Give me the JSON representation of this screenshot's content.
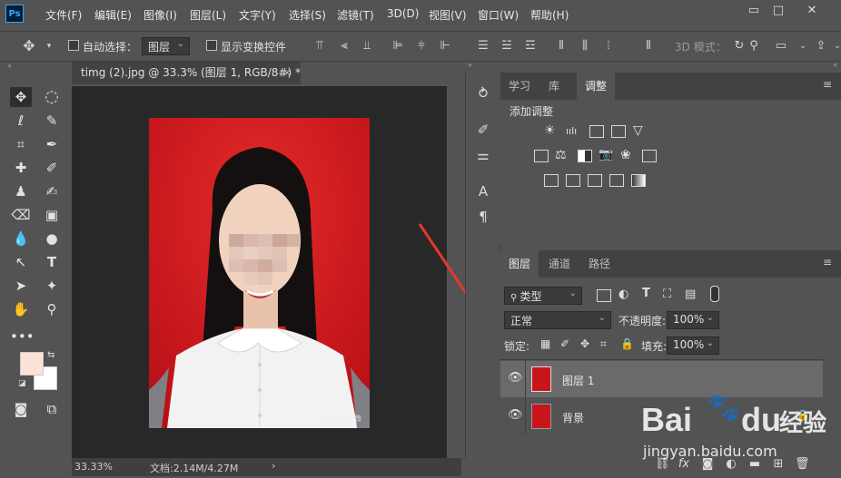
{
  "app": {
    "logo_text": "Ps"
  },
  "menu": [
    "文件(F)",
    "编辑(E)",
    "图像(I)",
    "图层(L)",
    "文字(Y)",
    "选择(S)",
    "滤镜(T)",
    "3D(D)",
    "视图(V)",
    "窗口(W)",
    "帮助(H)"
  ],
  "window_controls": {
    "minimize": "▭",
    "restore": "□",
    "close": "✕"
  },
  "options_bar": {
    "auto_select_label": "自动选择：",
    "layer_dropdown": "图层",
    "show_transform_label": "显示变换控件",
    "mode_3d_label": "3D 模式："
  },
  "document": {
    "tab_title": "timg (2).jpg @ 33.3% (图层 1, RGB/8#) *",
    "close_glyph": "×",
    "zoom": "33.33%",
    "doc_size": "文档:2.14M/4.27M",
    "watermark": "头条@小微"
  },
  "colors": {
    "foreground": "#fde3d7",
    "background": "#ffffff",
    "accent_arrow": "#e23a2e"
  },
  "adjust_panel": {
    "tabs": [
      "学习",
      "库",
      "调整"
    ],
    "active_tab": "调整",
    "title": "添加调整"
  },
  "layers_panel": {
    "tabs": [
      "图层",
      "通道",
      "路径"
    ],
    "active_tab": "图层",
    "filter_label": "类型",
    "blend_mode": "正常",
    "opacity_label": "不透明度:",
    "opacity_value": "100%",
    "lock_label": "锁定:",
    "fill_label": "填充:",
    "fill_value": "100%",
    "layers": [
      {
        "name": "图层 1",
        "visible": true,
        "selected": true
      },
      {
        "name": "背景",
        "visible": true,
        "locked": true
      }
    ],
    "footer_fx": "fx"
  },
  "watermark_site": {
    "brand": "Bai",
    "brand_suffix": "du",
    "brand_cn": "经验",
    "url": "jingyan.baidu.com"
  }
}
